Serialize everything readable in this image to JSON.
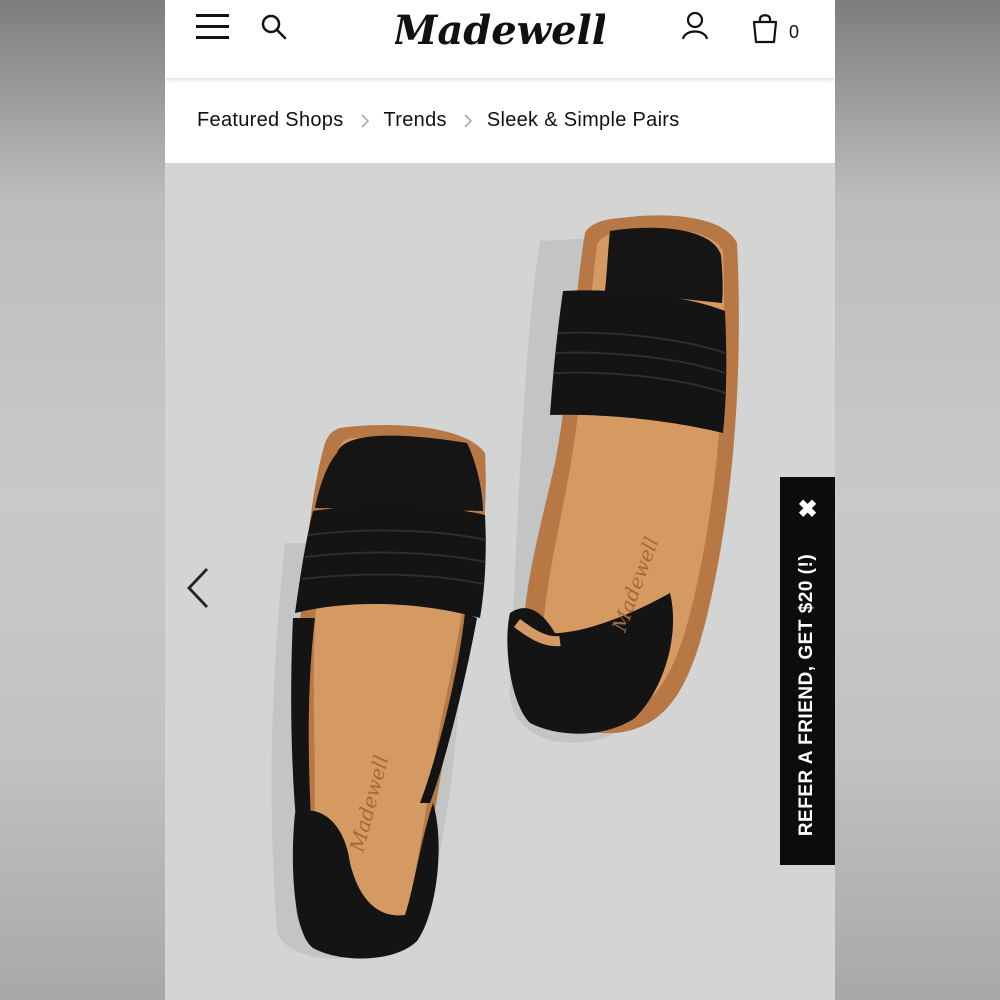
{
  "brand": {
    "name": "Madewell"
  },
  "header": {
    "icons": [
      "menu-icon",
      "search-icon",
      "account-icon",
      "bag-icon"
    ],
    "bag_count": "0"
  },
  "breadcrumb": {
    "items": [
      "Featured Shops",
      "Trends",
      "Sleek & Simple Pairs"
    ]
  },
  "product_image": {
    "subject": "black leather d'Orsay sandals",
    "insole_text": "Madewell"
  },
  "carousel": {
    "prev_icon": "chevron-left-icon"
  },
  "refer_tab": {
    "label": "REFER A FRIEND, GET $20 (!)",
    "close_label": "✖"
  },
  "colors": {
    "background_image": "#d3d4d4",
    "sandal_leather": "#121212",
    "sole": "#b77846",
    "insole": "#d59a62",
    "tab": "#0c0c0c"
  }
}
